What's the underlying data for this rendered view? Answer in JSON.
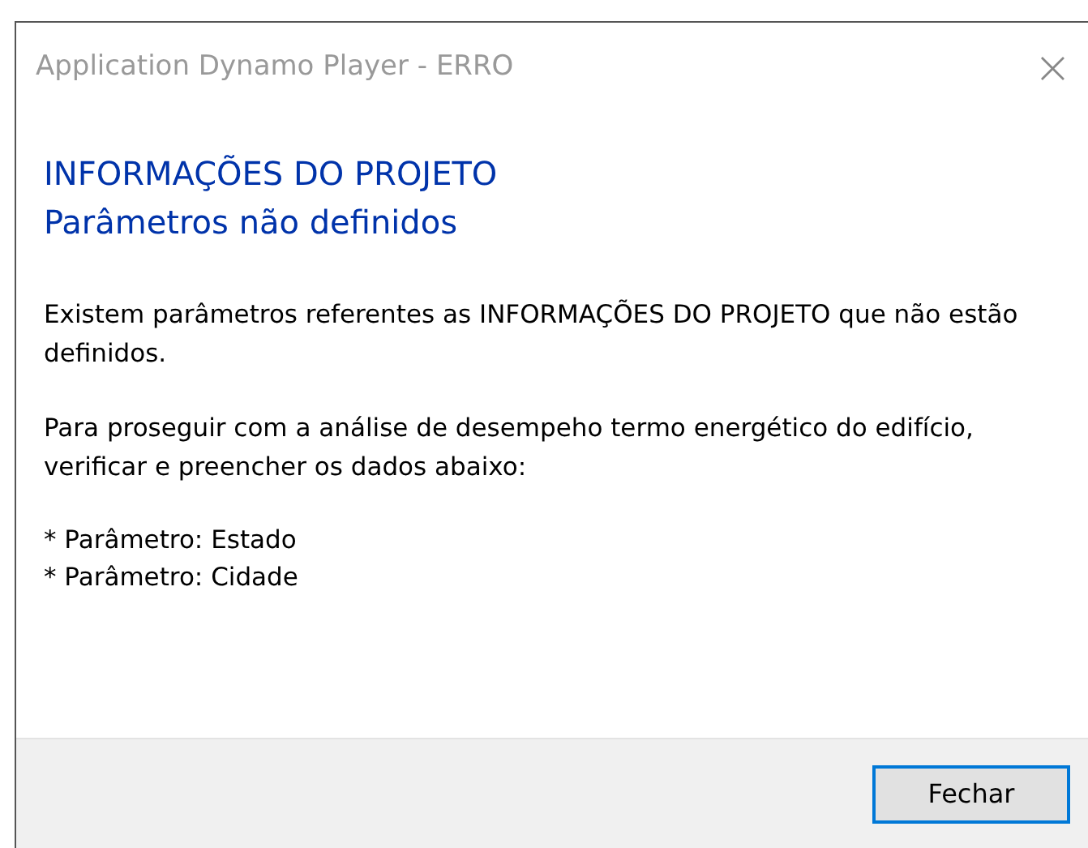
{
  "window": {
    "title": "Application Dynamo Player - ERRO",
    "close": "×"
  },
  "heading": [
    "INFORMAÇÕES DO PROJETO",
    "Parâmetros não definidos"
  ],
  "paragraphs": [
    "Existem parâmetros referentes as INFORMAÇÕES DO PROJETO que não estão definidos.",
    "Para proseguir com a análise de desempeho termo energético do edifício, verificar e preencher os dados abaixo:"
  ],
  "list": [
    "* Parâmetro: Estado",
    "* Parâmetro: Cidade"
  ],
  "buttons": [
    {
      "label": "Fechar",
      "focused": true
    }
  ]
}
